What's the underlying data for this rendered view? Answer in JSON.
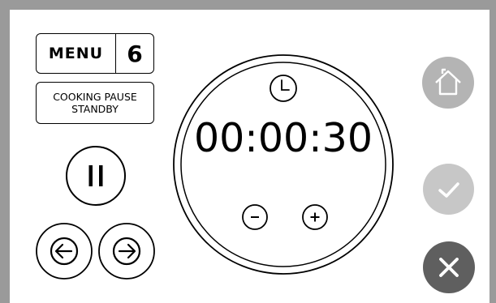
{
  "menu": {
    "label": "MENU",
    "number": "6"
  },
  "status": {
    "line1": "COOKING PAUSE",
    "line2": "STANDBY"
  },
  "timer": {
    "display": "00:00:30"
  },
  "icons": {
    "clock": "clock-icon",
    "decrease": "minus-icon",
    "increase": "plus-icon",
    "pause": "pause-icon",
    "previous": "arrow-left-icon",
    "next": "arrow-right-icon",
    "home": "home-icon",
    "confirm": "check-icon",
    "cancel": "close-icon"
  },
  "colors": {
    "frame": "#9a9a9a",
    "home_button": "#b4b4b4",
    "confirm_button": "#c7c7c7",
    "cancel_button": "#5f5f5f"
  }
}
